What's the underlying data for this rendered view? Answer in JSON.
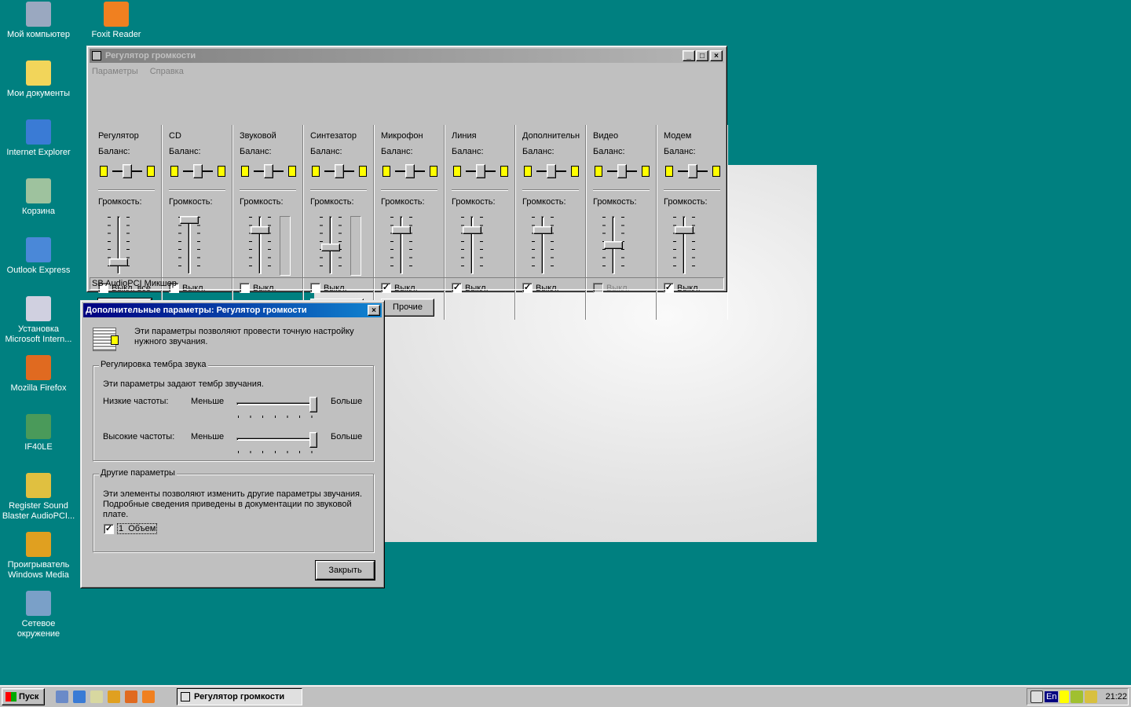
{
  "desktop": {
    "icons": [
      {
        "label": "Мой компьютер",
        "color": "#9aa8c0"
      },
      {
        "label": "Мои документы",
        "color": "#f2d55a"
      },
      {
        "label": "Internet Explorer",
        "color": "#3a7bd5"
      },
      {
        "label": "Корзина",
        "color": "#9ec29e"
      },
      {
        "label": "Outlook Express",
        "color": "#4a88d8"
      },
      {
        "label": "Установка Microsoft Intern...",
        "color": "#d0d0e0"
      },
      {
        "label": "Mozilla Firefox",
        "color": "#e06a20"
      },
      {
        "label": "IF40LE",
        "color": "#4a9a5a"
      },
      {
        "label": "Register Sound Blaster AudioPCI...",
        "color": "#e0c040"
      },
      {
        "label": "Проигрыватель Windows Media",
        "color": "#e0a020"
      },
      {
        "label": "Сетевое окружение",
        "color": "#7aa0c8"
      }
    ],
    "icons2": [
      {
        "label": "Foxit Reader",
        "color": "#f08020"
      }
    ]
  },
  "mixer": {
    "title": "Регулятор громкости",
    "menu": [
      "Параметры",
      "Справка"
    ],
    "balance_label": "Баланс:",
    "volume_label": "Громкость:",
    "advanced_label": "Прочие",
    "status": "SB AudioPCI Микшер",
    "channels": [
      {
        "name": "Регулятор",
        "mute_label": "Выкл. все",
        "muted": false,
        "volume": 0.15,
        "advanced": true,
        "disabled": false
      },
      {
        "name": "CD",
        "mute_label": "Выкл.",
        "muted": false,
        "volume": 1.0,
        "advanced": false,
        "disabled": false
      },
      {
        "name": "Звуковой",
        "mute_label": "Выкл.",
        "muted": false,
        "volume": 0.8,
        "advanced": false,
        "disabled": false,
        "meter": true
      },
      {
        "name": "Синтезатор",
        "mute_label": "Выкл.",
        "muted": false,
        "volume": 0.45,
        "advanced": true,
        "disabled": false,
        "meter": true
      },
      {
        "name": "Микрофон",
        "mute_label": "Выкл.",
        "muted": true,
        "volume": 0.8,
        "advanced": true,
        "disabled": false
      },
      {
        "name": "Линия",
        "mute_label": "Выкл.",
        "muted": true,
        "volume": 0.8,
        "advanced": false,
        "disabled": false
      },
      {
        "name": "Дополнительн",
        "mute_label": "Выкл.",
        "muted": true,
        "volume": 0.8,
        "advanced": false,
        "disabled": false
      },
      {
        "name": "Видео",
        "mute_label": "Выкл.",
        "muted": false,
        "volume": 0.5,
        "advanced": false,
        "disabled": true
      },
      {
        "name": "Модем",
        "mute_label": "Выкл.",
        "muted": true,
        "volume": 0.8,
        "advanced": false,
        "disabled": false
      }
    ]
  },
  "dialog": {
    "title": "Дополнительные параметры: Регулятор громкости",
    "intro": "Эти параметры позволяют провести точную настройку нужного звучания.",
    "tone": {
      "legend": "Регулировка тембра звука",
      "desc": "Эти параметры задают тембр звучания.",
      "bass_label": "Низкие частоты:",
      "treble_label": "Высокие частоты:",
      "less": "Меньше",
      "more": "Больше",
      "bass": 1.0,
      "treble": 1.0
    },
    "other": {
      "legend": "Другие параметры",
      "desc": "Эти элементы позволяют изменить другие параметры звучания. Подробные сведения приведены в документации по звуковой плате.",
      "option_label": "1  Объем",
      "option_checked": true
    },
    "close_label": "Закрыть"
  },
  "taskbar": {
    "start_label": "Пуск",
    "task_label": "Регулятор громкости",
    "lang": "En",
    "clock": "21:22"
  }
}
